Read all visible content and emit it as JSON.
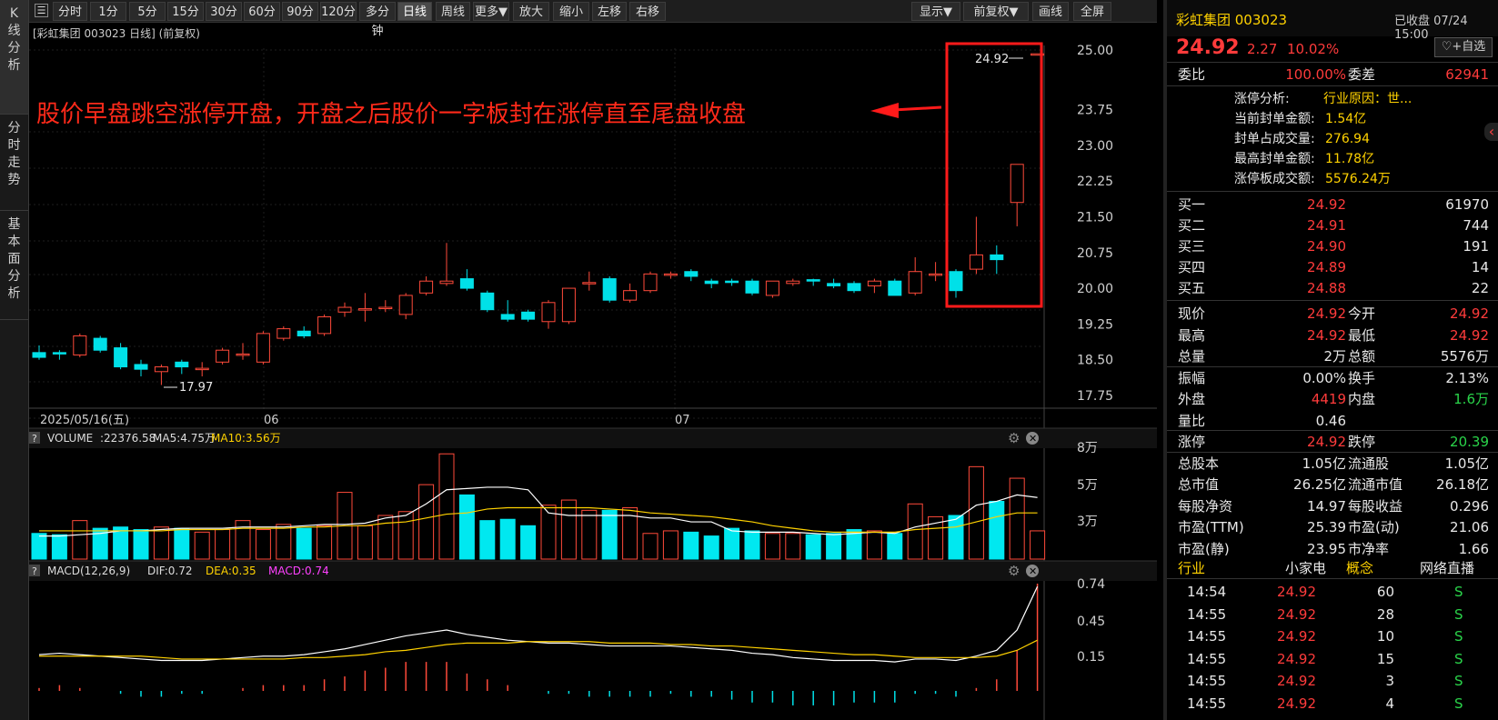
{
  "left_tabs": [
    "K线分析",
    "分时走势",
    "基本面分析"
  ],
  "toolbar": {
    "items": [
      "分时",
      "1分",
      "5分",
      "15分",
      "30分",
      "60分",
      "90分",
      "120分",
      "多分钟",
      "日线",
      "周线",
      "更多▼",
      "放大",
      "缩小",
      "左移",
      "右移"
    ],
    "right_items": [
      "显示▼",
      "前复权▼",
      "画线",
      "全屏"
    ],
    "active": "日线"
  },
  "chart": {
    "subtitle": "[彩虹集团 003023 日线] (前复权)",
    "annotation": "股价早盘跳空涨停开盘，开盘之后股价一字板封在涨停直至尾盘收盘",
    "high_label": "24.92",
    "low_label": "17.97",
    "x_labels": [
      "2025/05/16(五)",
      "06",
      "07"
    ],
    "y_labels": [
      "25.00",
      "23.75",
      "23.00",
      "22.25",
      "21.50",
      "20.75",
      "20.00",
      "19.25",
      "18.50",
      "17.75"
    ]
  },
  "volume": {
    "label": "VOLUME",
    "value": ":22376.58",
    "ma5": "MA5:4.75万",
    "ma10": "MA10:3.56万",
    "y_labels": [
      "8万",
      "5万",
      "3万"
    ]
  },
  "macd": {
    "label": "MACD(12,26,9)",
    "dif": "DIF:0.72",
    "dea": "DEA:0.35",
    "macd": "MACD:0.74",
    "y_labels": [
      "0.74",
      "0.45",
      "0.15"
    ]
  },
  "quote": {
    "name": "彩虹集团 003023",
    "status": "已收盘 07/24 15:00",
    "price": "24.92",
    "change": "2.27",
    "pct": "10.02%",
    "fav": "+自选",
    "weibi_label": "委比",
    "weibi": "100.00%",
    "weicha_label": "委差",
    "weicha": "62941"
  },
  "limit_info": [
    {
      "k": "涨停分析:",
      "v": "行业原因：世..."
    },
    {
      "k": "当前封单金额:",
      "v": "1.54亿"
    },
    {
      "k": "封单占成交量:",
      "v": "276.94"
    },
    {
      "k": "最高封单金额:",
      "v": "11.78亿"
    },
    {
      "k": "涨停板成交额:",
      "v": "5576.24万"
    }
  ],
  "bids": [
    {
      "l": "买一",
      "p": "24.92",
      "v": "61970"
    },
    {
      "l": "买二",
      "p": "24.91",
      "v": "744"
    },
    {
      "l": "买三",
      "p": "24.90",
      "v": "191"
    },
    {
      "l": "买四",
      "p": "24.89",
      "v": "14"
    },
    {
      "l": "买五",
      "p": "24.88",
      "v": "22"
    }
  ],
  "stats": [
    [
      "现价",
      "24.92",
      "今开",
      "24.92"
    ],
    [
      "最高",
      "24.92",
      "最低",
      "24.92"
    ],
    [
      "总量",
      "2万",
      "总额",
      "5576万"
    ],
    [
      "振幅",
      "0.00%",
      "换手",
      "2.13%"
    ],
    [
      "外盘",
      "4419",
      "内盘",
      "1.6万"
    ],
    [
      "量比",
      "0.46",
      "",
      ""
    ],
    [
      "涨停",
      "24.92",
      "跌停",
      "20.39"
    ],
    [
      "总股本",
      "1.05亿",
      "流通股",
      "1.05亿"
    ],
    [
      "总市值",
      "26.25亿",
      "流通市值",
      "26.18亿"
    ],
    [
      "每股净资",
      "14.97",
      "每股收益",
      "0.296"
    ],
    [
      "市盈(TTM)",
      "25.39",
      "市盈(动)",
      "21.06"
    ],
    [
      "市盈(静)",
      "23.95",
      "市净率",
      "1.66"
    ]
  ],
  "tabs": [
    "行业",
    "小家电",
    "概念",
    "网络直播"
  ],
  "ticks": [
    [
      "14:54",
      "24.92",
      "60",
      "S"
    ],
    [
      "14:55",
      "24.92",
      "28",
      "S"
    ],
    [
      "14:55",
      "24.92",
      "10",
      "S"
    ],
    [
      "14:55",
      "24.92",
      "15",
      "S"
    ],
    [
      "14:55",
      "24.92",
      "3",
      "S"
    ],
    [
      "14:55",
      "24.92",
      "4",
      "S"
    ]
  ],
  "chart_data": {
    "type": "candlestick",
    "x": [
      "2025/05/16",
      "06",
      "07"
    ],
    "ylim": [
      17.75,
      25.0
    ],
    "high": 24.92,
    "low": 17.97,
    "candles": [
      [
        18.65,
        18.55,
        18.8,
        18.5
      ],
      [
        18.65,
        18.62,
        18.7,
        18.5
      ],
      [
        18.6,
        19.0,
        19.05,
        18.55
      ],
      [
        18.95,
        18.7,
        19.0,
        18.65
      ],
      [
        18.75,
        18.35,
        18.85,
        18.3
      ],
      [
        18.4,
        18.3,
        18.5,
        18.15
      ],
      [
        18.25,
        18.35,
        18.4,
        17.97
      ],
      [
        18.45,
        18.35,
        18.5,
        18.2
      ],
      [
        18.3,
        18.32,
        18.45,
        18.15
      ],
      [
        18.45,
        18.7,
        18.75,
        18.4
      ],
      [
        18.6,
        18.62,
        18.85,
        18.5
      ],
      [
        18.45,
        19.05,
        19.1,
        18.4
      ],
      [
        18.95,
        19.15,
        19.2,
        18.9
      ],
      [
        19.1,
        19.0,
        19.2,
        18.95
      ],
      [
        19.05,
        19.4,
        19.45,
        19.0
      ],
      [
        19.5,
        19.6,
        19.7,
        19.4
      ],
      [
        19.55,
        19.57,
        19.9,
        19.3
      ],
      [
        19.6,
        19.6,
        19.75,
        19.5
      ],
      [
        19.45,
        19.85,
        19.9,
        19.35
      ],
      [
        19.9,
        20.15,
        20.25,
        19.85
      ],
      [
        20.1,
        20.15,
        20.95,
        20.05
      ],
      [
        20.2,
        20.0,
        20.4,
        19.95
      ],
      [
        19.9,
        19.55,
        19.95,
        19.5
      ],
      [
        19.45,
        19.35,
        19.75,
        19.3
      ],
      [
        19.5,
        19.35,
        19.55,
        19.3
      ],
      [
        19.3,
        19.7,
        19.75,
        19.15
      ],
      [
        19.3,
        20.0,
        20.0,
        19.25
      ],
      [
        20.1,
        20.12,
        20.35,
        19.95
      ],
      [
        20.2,
        19.75,
        20.25,
        19.7
      ],
      [
        19.75,
        19.95,
        20.1,
        19.7
      ],
      [
        19.95,
        20.3,
        20.35,
        19.9
      ],
      [
        20.3,
        20.3,
        20.35,
        20.2
      ],
      [
        20.35,
        20.25,
        20.4,
        20.15
      ],
      [
        20.15,
        20.1,
        20.2,
        20.0
      ],
      [
        20.15,
        20.12,
        20.2,
        20.05
      ],
      [
        20.15,
        19.9,
        20.2,
        19.85
      ],
      [
        19.85,
        20.15,
        20.15,
        19.8
      ],
      [
        20.1,
        20.15,
        20.2,
        20.05
      ],
      [
        20.18,
        20.15,
        20.2,
        20.05
      ],
      [
        20.1,
        20.05,
        20.2,
        20.0
      ],
      [
        20.1,
        19.95,
        20.15,
        19.9
      ],
      [
        20.05,
        20.15,
        20.2,
        19.9
      ],
      [
        20.15,
        19.85,
        20.2,
        19.85
      ],
      [
        19.9,
        20.35,
        20.65,
        19.85
      ],
      [
        20.3,
        20.3,
        20.55,
        20.15
      ],
      [
        20.35,
        19.95,
        20.4,
        19.8
      ],
      [
        20.4,
        20.7,
        21.5,
        20.3
      ],
      [
        20.7,
        20.6,
        20.9,
        20.3
      ],
      [
        21.8,
        22.6,
        22.6,
        21.3
      ],
      [
        24.92,
        24.92,
        24.92,
        24.92
      ]
    ],
    "volume": [
      2.0,
      1.9,
      3.0,
      2.4,
      2.5,
      2.3,
      2.5,
      2.4,
      2.1,
      2.3,
      3.0,
      2.3,
      2.7,
      2.4,
      2.6,
      5.2,
      2.6,
      3.4,
      3.7,
      5.8,
      8.2,
      5.0,
      3.0,
      3.1,
      2.6,
      4.2,
      4.6,
      3.8,
      3.8,
      4.0,
      2.0,
      2.2,
      2.1,
      1.8,
      2.4,
      2.2,
      2.0,
      2.0,
      1.9,
      2.0,
      2.3,
      2.2,
      2.0,
      4.3,
      3.3,
      3.4,
      7.2,
      4.5,
      6.3,
      2.2
    ],
    "ma5": [
      1.8,
      1.8,
      1.9,
      2.0,
      2.2,
      2.2,
      2.3,
      2.4,
      2.4,
      2.4,
      2.5,
      2.5,
      2.5,
      2.6,
      2.7,
      2.7,
      2.8,
      3.2,
      3.4,
      4.3,
      5.4,
      5.5,
      5.6,
      5.6,
      5.4,
      3.6,
      3.4,
      3.4,
      3.4,
      3.4,
      3.2,
      3.2,
      2.9,
      2.9,
      2.2,
      2.1,
      2.1,
      2.1,
      2.0,
      1.9,
      2.0,
      2.1,
      2.0,
      2.5,
      2.8,
      3.1,
      4.2,
      4.5,
      5.0,
      4.8
    ],
    "ma10": [
      2.2,
      2.2,
      2.2,
      2.2,
      2.2,
      2.2,
      2.2,
      2.3,
      2.3,
      2.3,
      2.4,
      2.4,
      2.4,
      2.5,
      2.5,
      2.6,
      2.6,
      2.8,
      2.9,
      3.2,
      3.5,
      3.6,
      3.9,
      4.0,
      4.0,
      4.0,
      4.0,
      4.0,
      3.9,
      3.8,
      3.6,
      3.5,
      3.4,
      3.3,
      3.1,
      2.9,
      2.6,
      2.4,
      2.2,
      2.1,
      2.1,
      2.1,
      2.1,
      2.3,
      2.4,
      2.5,
      2.9,
      3.3,
      3.6,
      3.6
    ],
    "dif": [
      0.25,
      0.26,
      0.25,
      0.24,
      0.23,
      0.22,
      0.21,
      0.21,
      0.21,
      0.22,
      0.23,
      0.24,
      0.24,
      0.25,
      0.27,
      0.29,
      0.32,
      0.35,
      0.38,
      0.4,
      0.42,
      0.39,
      0.37,
      0.35,
      0.34,
      0.33,
      0.33,
      0.32,
      0.31,
      0.31,
      0.31,
      0.31,
      0.3,
      0.29,
      0.28,
      0.26,
      0.25,
      0.23,
      0.22,
      0.21,
      0.21,
      0.21,
      0.2,
      0.22,
      0.22,
      0.21,
      0.24,
      0.28,
      0.42,
      0.72
    ],
    "dea": [
      0.24,
      0.24,
      0.24,
      0.24,
      0.24,
      0.24,
      0.23,
      0.22,
      0.22,
      0.22,
      0.22,
      0.22,
      0.22,
      0.23,
      0.23,
      0.24,
      0.25,
      0.27,
      0.28,
      0.3,
      0.32,
      0.33,
      0.33,
      0.33,
      0.34,
      0.34,
      0.34,
      0.34,
      0.33,
      0.33,
      0.33,
      0.32,
      0.32,
      0.31,
      0.31,
      0.3,
      0.29,
      0.28,
      0.27,
      0.26,
      0.25,
      0.25,
      0.24,
      0.23,
      0.23,
      0.23,
      0.23,
      0.24,
      0.28,
      0.35
    ]
  }
}
